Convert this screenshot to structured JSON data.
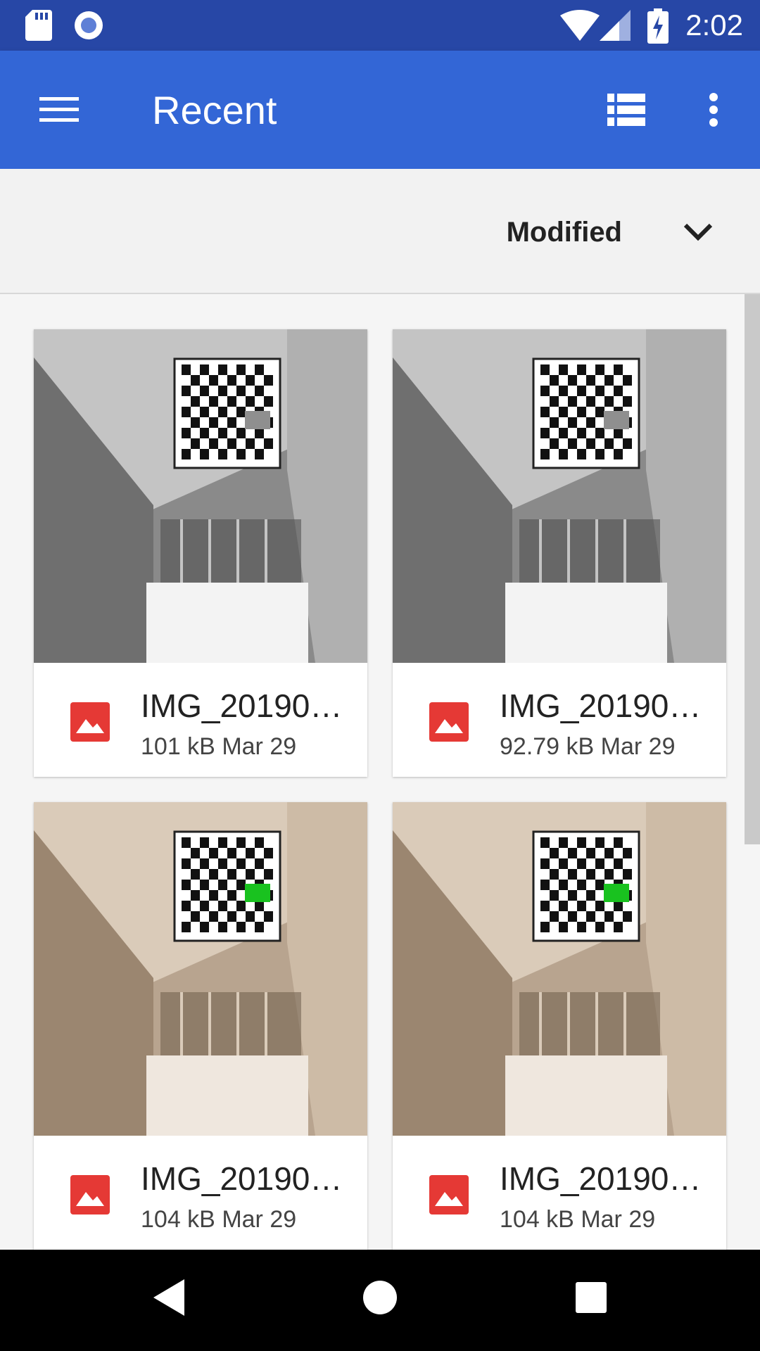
{
  "status_bar": {
    "time": "2:02",
    "icons": [
      "sd-card-icon",
      "record-icon",
      "wifi-icon",
      "signal-icon",
      "battery-charging-icon"
    ]
  },
  "app_bar": {
    "title": "Recent",
    "menu_icon": "hamburger-icon",
    "view_icon": "list-view-icon",
    "overflow_icon": "more-vert-icon"
  },
  "sort": {
    "label": "Modified",
    "icon": "chevron-down-icon"
  },
  "files": [
    {
      "name": "IMG_20190…",
      "size": "101 kB",
      "date": "Mar 29",
      "tone": "gray",
      "marker": "gray"
    },
    {
      "name": "IMG_20190…",
      "size": "92.79 kB",
      "date": "Mar 29",
      "tone": "gray",
      "marker": "gray"
    },
    {
      "name": "IMG_20190…",
      "size": "104 kB",
      "date": "Mar 29",
      "tone": "sepia",
      "marker": "green"
    },
    {
      "name": "IMG_20190…",
      "size": "104 kB",
      "date": "Mar 29",
      "tone": "sepia",
      "marker": "green"
    }
  ],
  "colors": {
    "status_bar": "#2747a6",
    "app_bar": "#3366d6",
    "image_icon": "#e53935"
  },
  "nav_bar": {
    "icons": [
      "back-icon",
      "home-icon",
      "recents-icon"
    ]
  }
}
